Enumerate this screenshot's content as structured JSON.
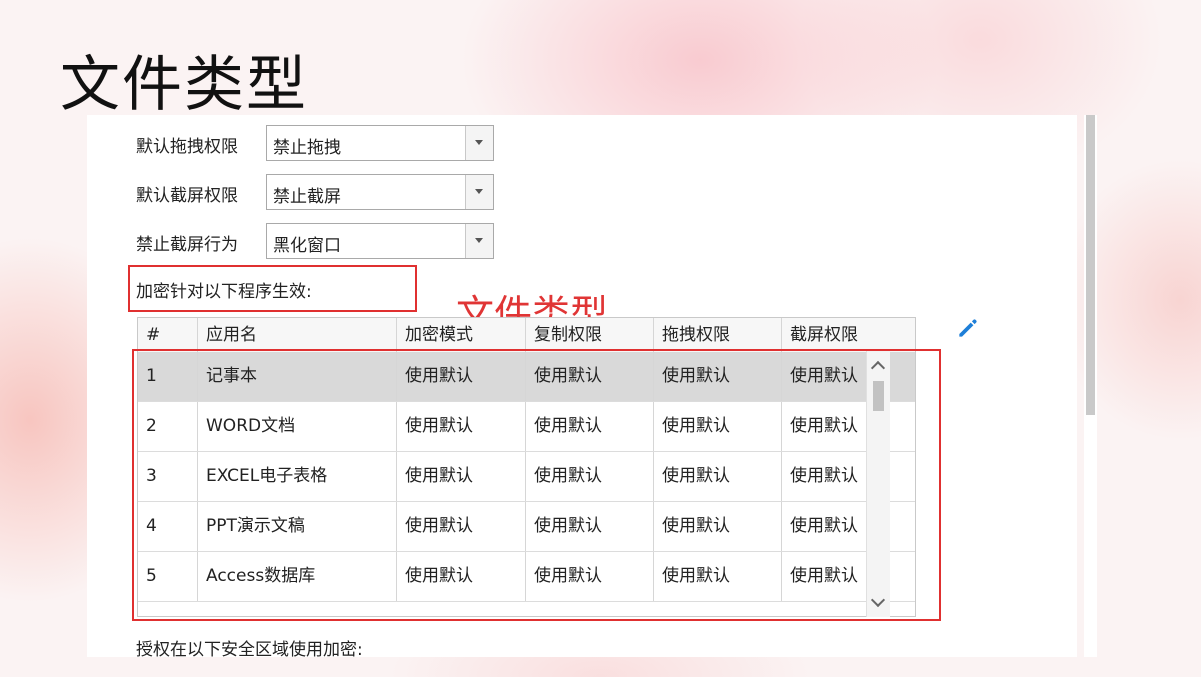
{
  "slide_title": "文件类型",
  "settings": [
    {
      "label": "默认拖拽权限",
      "value": "禁止拖拽"
    },
    {
      "label": "默认截屏权限",
      "value": "禁止截屏"
    },
    {
      "label": "禁止截屏行为",
      "value": "黑化窗口"
    }
  ],
  "encrypt_label": "加密针对以下程序生效:",
  "annotation": "文件类型",
  "table": {
    "headers": [
      "#",
      "应用名",
      "加密模式",
      "复制权限",
      "拖拽权限",
      "截屏权限"
    ],
    "rows": [
      [
        "1",
        "记事本",
        "使用默认",
        "使用默认",
        "使用默认",
        "使用默认"
      ],
      [
        "2",
        "WORD文档",
        "使用默认",
        "使用默认",
        "使用默认",
        "使用默认"
      ],
      [
        "3",
        "EXCEL电子表格",
        "使用默认",
        "使用默认",
        "使用默认",
        "使用默认"
      ],
      [
        "4",
        "PPT演示文稿",
        "使用默认",
        "使用默认",
        "使用默认",
        "使用默认"
      ],
      [
        "5",
        "Access数据库",
        "使用默认",
        "使用默认",
        "使用默认",
        "使用默认"
      ]
    ]
  },
  "footer_label": "授权在以下安全区域使用加密:",
  "colors": {
    "highlight_red": "#e03030",
    "edit_blue": "#1e7fd8",
    "selected_row": "#d9d9d9"
  }
}
